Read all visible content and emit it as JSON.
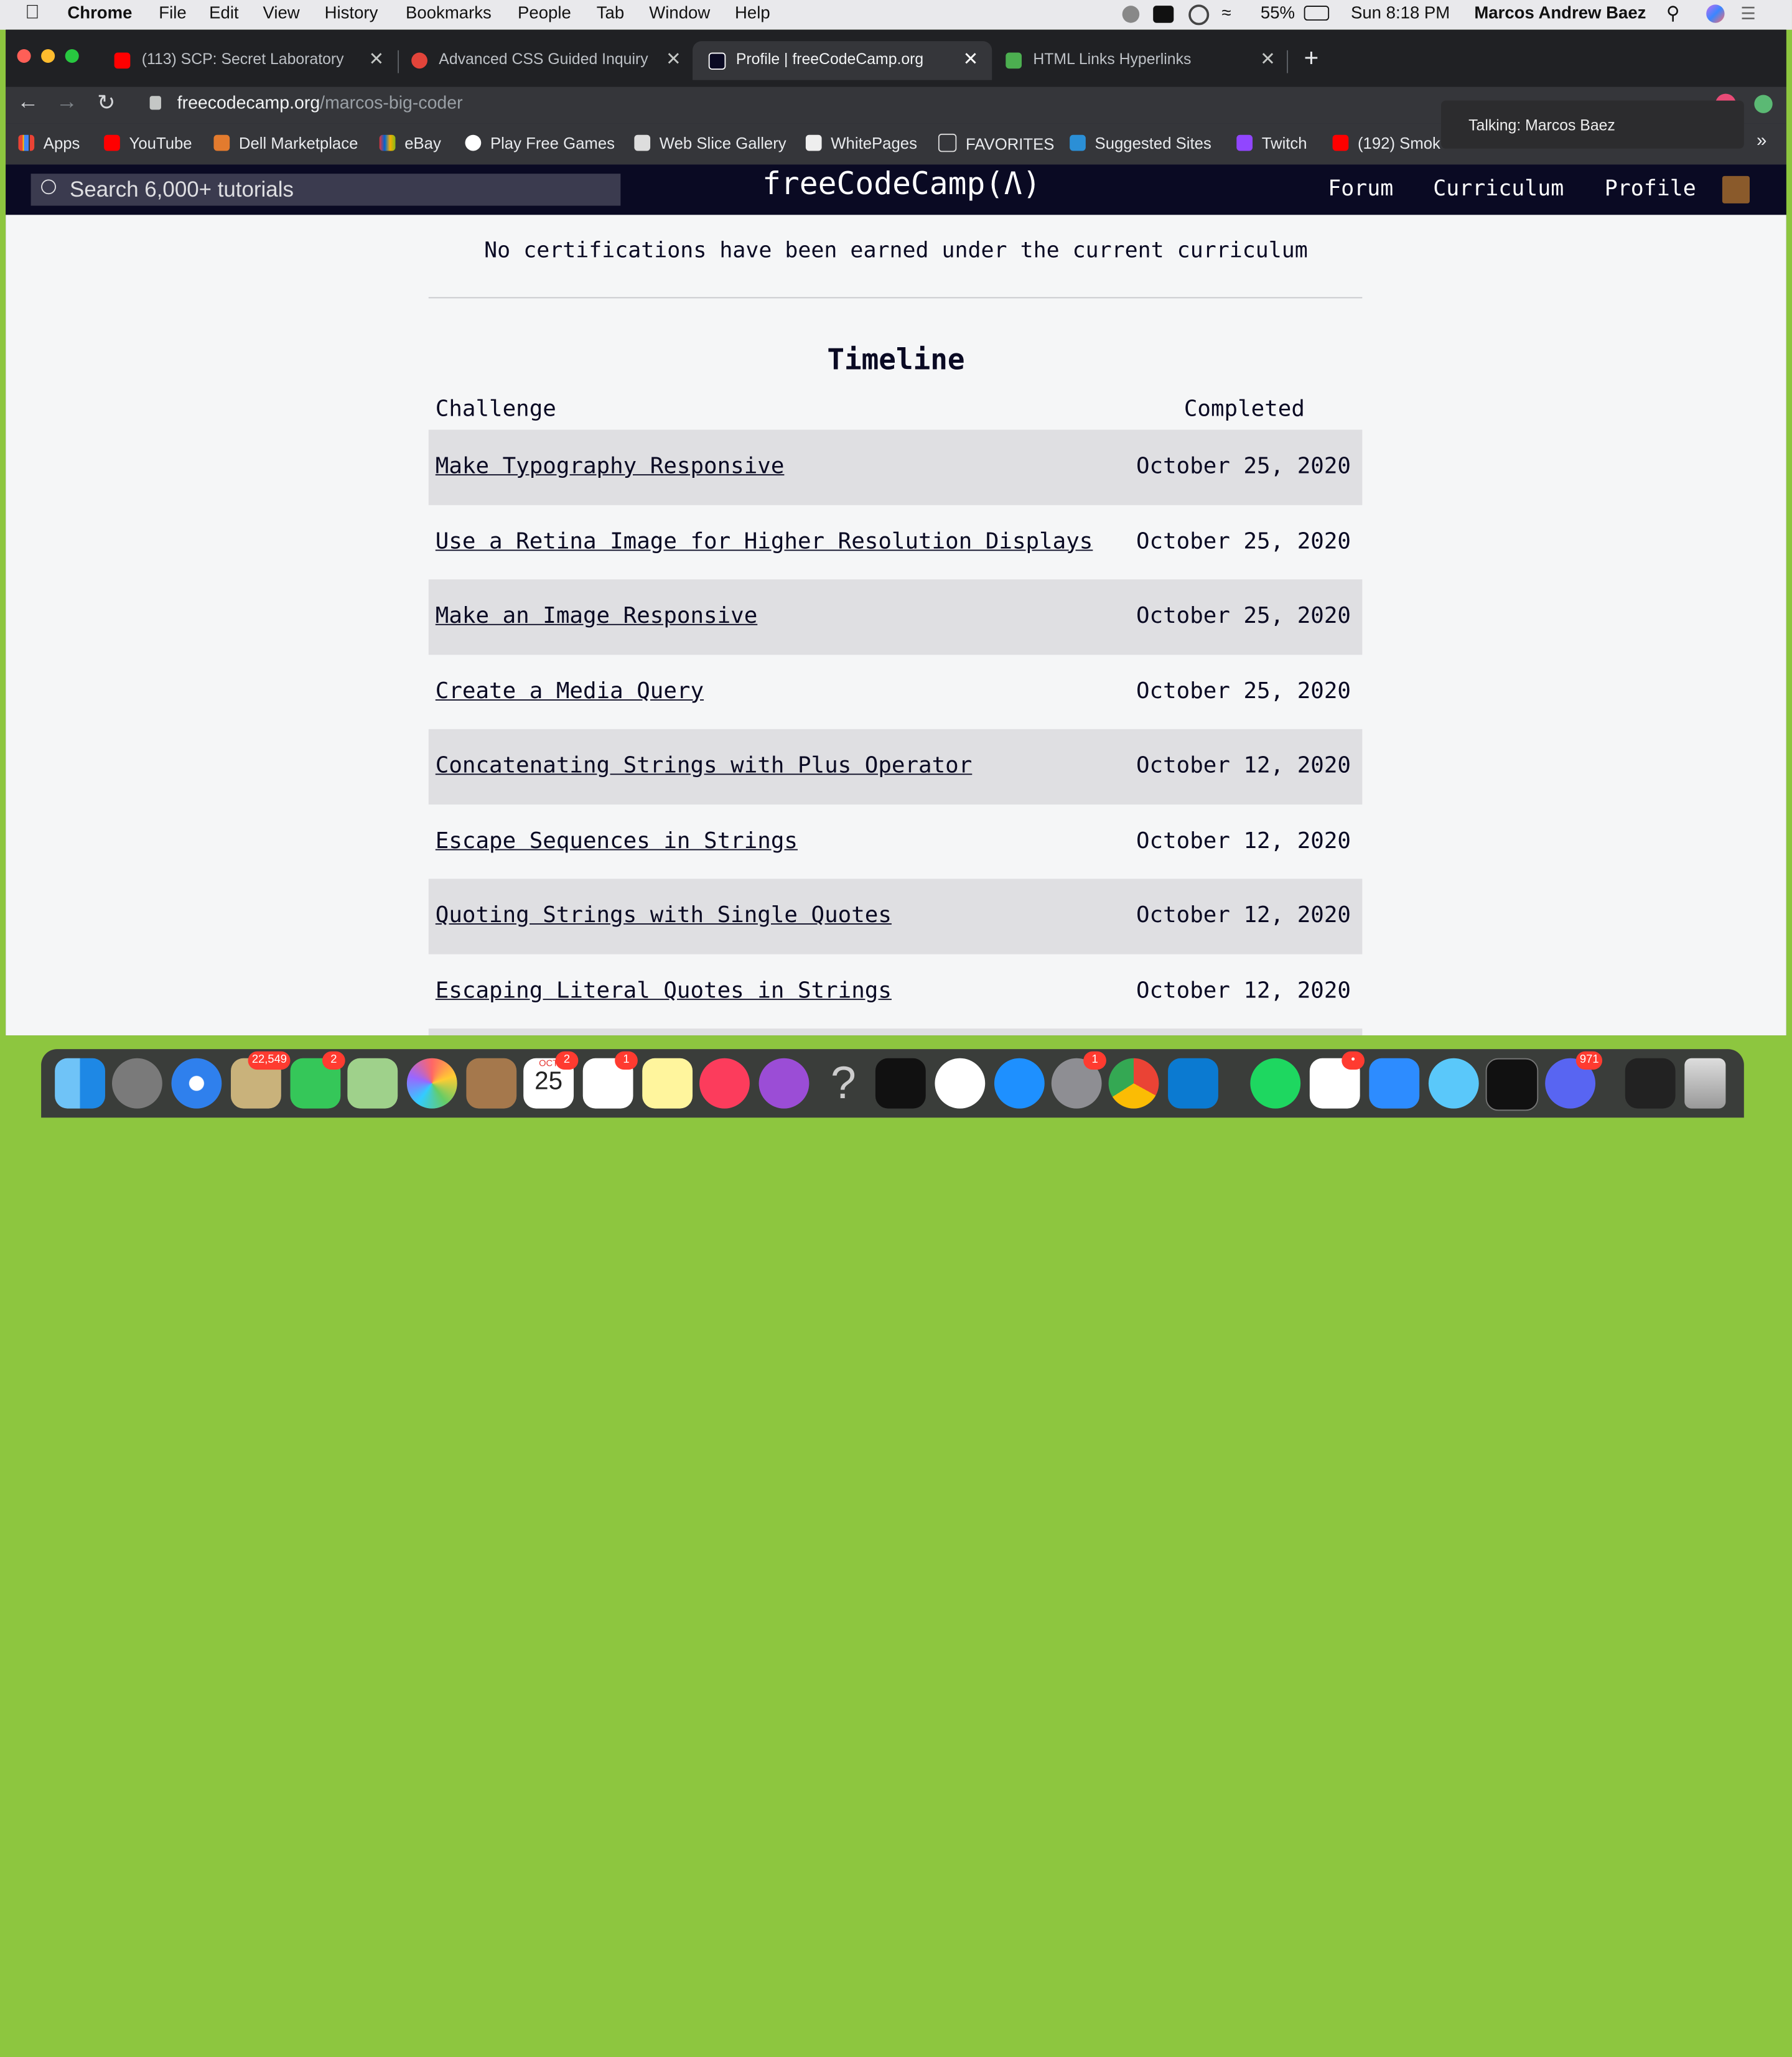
{
  "menubar": {
    "apple": "",
    "app": "Chrome",
    "items": [
      "File",
      "Edit",
      "View",
      "History",
      "Bookmarks",
      "People",
      "Tab",
      "Window",
      "Help"
    ],
    "battery": "55%",
    "clock": "Sun 8:18 PM",
    "user": "Marcos Andrew Baez"
  },
  "tabs": [
    {
      "title": "(113) SCP: Secret Laboratory -",
      "icon": "youtube-icon",
      "active": false
    },
    {
      "title": "Advanced CSS Guided Inquiry",
      "icon": "settings-icon",
      "active": false
    },
    {
      "title": "Profile | freeCodeCamp.org",
      "icon": "freecodecamp-icon",
      "active": true
    },
    {
      "title": "HTML Links Hyperlinks",
      "icon": "page-icon",
      "active": false
    }
  ],
  "address": {
    "domain": "freecodecamp.org",
    "path": "/marcos-big-coder"
  },
  "bookmarks": [
    "Apps",
    "YouTube",
    "Dell Marketplace",
    "eBay",
    "Play Free Games",
    "Web Slice Gallery",
    "WhitePages",
    "FAVORITES",
    "Suggested Sites",
    "Twitch",
    "(192) Smok"
  ],
  "tooltip": "Talking: Marcos Baez",
  "fcc": {
    "search_placeholder": "Search 6,000+ tutorials",
    "logo": "freeCodeCamp(Ʌ)",
    "nav": [
      "Forum",
      "Curriculum",
      "Profile"
    ]
  },
  "page": {
    "no_cert": "No certifications have been earned under the current curriculum",
    "timeline_title": "Timeline",
    "col_challenge": "Challenge",
    "col_completed": "Completed",
    "rows": [
      {
        "challenge": "Make Typography Responsive",
        "date": "October 25, 2020"
      },
      {
        "challenge": "Use a Retina Image for Higher Resolution Displays",
        "date": "October 25, 2020"
      },
      {
        "challenge": "Make an Image Responsive",
        "date": "October 25, 2020"
      },
      {
        "challenge": "Create a Media Query",
        "date": "October 25, 2020"
      },
      {
        "challenge": "Concatenating Strings with Plus Operator",
        "date": "October 12, 2020"
      },
      {
        "challenge": "Escape Sequences in Strings",
        "date": "October 12, 2020"
      },
      {
        "challenge": "Quoting Strings with Single Quotes",
        "date": "October 12, 2020"
      },
      {
        "challenge": "Escaping Literal Quotes in Strings",
        "date": "October 12, 2020"
      }
    ]
  },
  "dock": {
    "calendar_month": "OCT",
    "calendar_day": "25",
    "badges": {
      "mail": "22,549",
      "facetime": "2",
      "calendar": "2",
      "reminders": "1",
      "system_prefs": "1",
      "slack": "•",
      "discord": "971"
    }
  },
  "colors": {
    "fcc_nav": "#0a0a23",
    "page_bg": "#f5f6f7",
    "row_alt": "#dfdfe2",
    "desktop": "#8dc63f"
  }
}
